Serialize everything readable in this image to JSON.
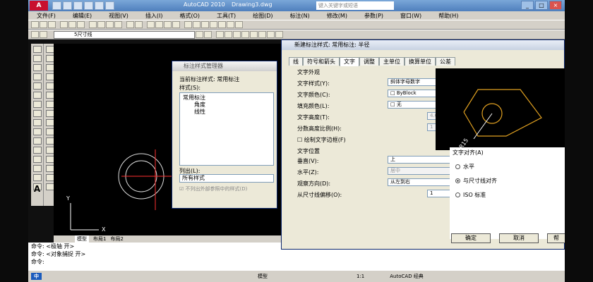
{
  "title_bar": {
    "app_title": "AutoCAD 2010",
    "file_name": "Drawing3.dwg",
    "search_placeholder": "键入关键字或短语",
    "app_logo_icon": "autocad-logo-icon"
  },
  "menu": [
    "文件(F)",
    "编辑(E)",
    "视图(V)",
    "插入(I)",
    "格式(O)",
    "工具(T)",
    "绘图(D)",
    "标注(N)",
    "修改(M)",
    "参数(P)",
    "窗口(W)",
    "帮助(H)"
  ],
  "layer_toolbar": {
    "current_layer": "5尺寸线"
  },
  "tabs": {
    "model": "模型",
    "layout1": "布局1",
    "layout2": "布局2"
  },
  "command_lines": [
    "命令: <极轴 开>",
    "命令: <对象捕捉 开>",
    "命令:"
  ],
  "status": {
    "model": "模型",
    "scale": "1:1",
    "workspace": "AutoCAD 经典",
    "ime": "中"
  },
  "dialog_manager": {
    "title": "标注样式管理器",
    "current_style_label": "当前标注样式: 常用标注",
    "styles_label": "样式(S):",
    "tree": {
      "root": "常用标注",
      "children": [
        "角度",
        "线性"
      ]
    },
    "list_label": "列出(L):",
    "list_value": "所有样式",
    "xref_checkbox": "不列出外部参照中的样式(D)"
  },
  "dialog_new": {
    "title": "新建标注样式: 常用标注: 半径",
    "tabs": [
      "线",
      "符号和箭头",
      "文字",
      "调整",
      "主单位",
      "换算单位",
      "公差"
    ],
    "active_tab": "文字",
    "text_appearance": {
      "heading": "文字外观",
      "style_label": "文字样式(Y):",
      "style_value": "斜体字母数字",
      "color_label": "文字颜色(C):",
      "color_value": "ByBlock",
      "fill_label": "填充颜色(L):",
      "fill_value": "无",
      "height_label": "文字高度(T):",
      "height_value": "4.6",
      "fraction_label": "分数高度比例(H):",
      "fraction_value": "1",
      "frame_label": "绘制文字边框(F)",
      "ellipsis_button": "..."
    },
    "text_position": {
      "heading": "文字位置",
      "vertical_label": "垂直(V):",
      "vertical_value": "上",
      "horizontal_label": "水平(Z):",
      "horizontal_value": "居中",
      "view_dir_label": "观察方向(D):",
      "view_dir_value": "从左到右",
      "offset_label": "从尺寸线偏移(O):",
      "offset_value": "1"
    },
    "text_alignment": {
      "heading": "文字对齐(A)",
      "options": [
        "水平",
        "与尺寸线对齐",
        "ISO 标准"
      ],
      "selected": "与尺寸线对齐"
    },
    "buttons": {
      "ok": "确定",
      "cancel": "取消",
      "help": "帮"
    },
    "preview_label": "R15"
  },
  "colors": {
    "titlebar": "#4f7fbd",
    "preview_shape": "#e0a020",
    "dialog_bg": "#ece9d8"
  }
}
